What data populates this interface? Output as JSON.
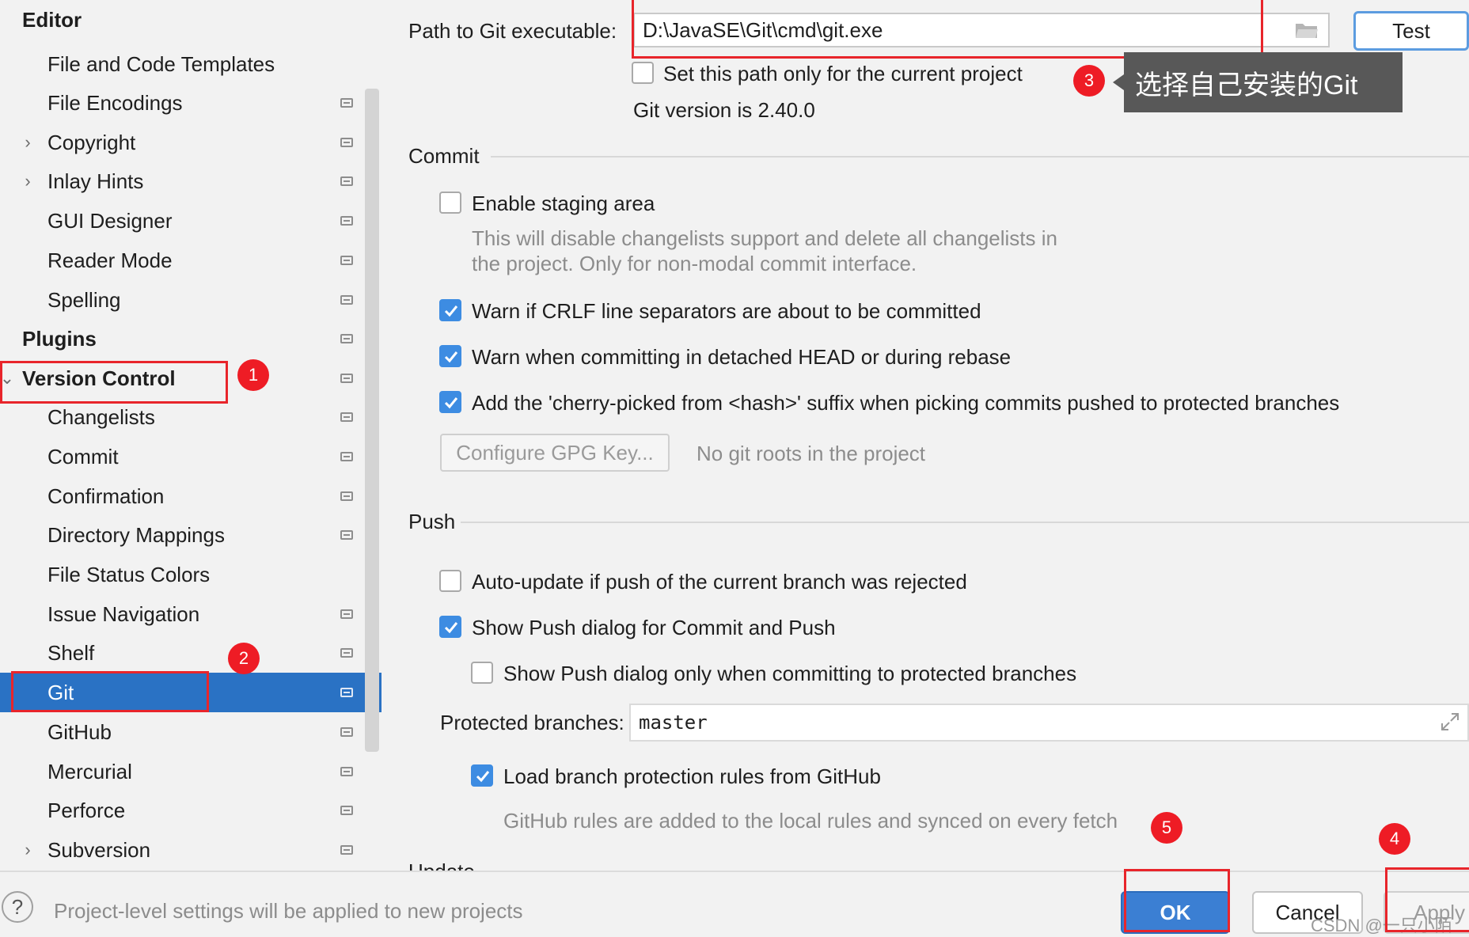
{
  "sidebar": {
    "items": [
      {
        "label": "Editor",
        "header": true,
        "chevron": "none"
      },
      {
        "label": "File and Code Templates",
        "chevron": "none",
        "project_icon": false
      },
      {
        "label": "File Encodings",
        "chevron": "none",
        "project_icon": true
      },
      {
        "label": "Copyright",
        "chevron": "collapsed",
        "project_icon": true
      },
      {
        "label": "Inlay Hints",
        "chevron": "collapsed",
        "project_icon": true
      },
      {
        "label": "GUI Designer",
        "chevron": "none",
        "project_icon": true
      },
      {
        "label": "Reader Mode",
        "chevron": "none",
        "project_icon": true
      },
      {
        "label": "Spelling",
        "chevron": "none",
        "project_icon": true
      },
      {
        "label": "Plugins",
        "header": true,
        "chevron": "none",
        "project_icon": true
      },
      {
        "label": "Version Control",
        "header": true,
        "chevron": "expanded",
        "project_icon": true
      },
      {
        "label": "Changelists",
        "chevron": "none",
        "project_icon": true
      },
      {
        "label": "Commit",
        "chevron": "none",
        "project_icon": true
      },
      {
        "label": "Confirmation",
        "chevron": "none",
        "project_icon": true
      },
      {
        "label": "Directory Mappings",
        "chevron": "none",
        "project_icon": true
      },
      {
        "label": "File Status Colors",
        "chevron": "none",
        "project_icon": false
      },
      {
        "label": "Issue Navigation",
        "chevron": "none",
        "project_icon": true
      },
      {
        "label": "Shelf",
        "chevron": "none",
        "project_icon": true
      },
      {
        "label": "Git",
        "chevron": "none",
        "project_icon": true,
        "selected": true
      },
      {
        "label": "GitHub",
        "chevron": "none",
        "project_icon": true
      },
      {
        "label": "Mercurial",
        "chevron": "none",
        "project_icon": true
      },
      {
        "label": "Perforce",
        "chevron": "none",
        "project_icon": true
      },
      {
        "label": "Subversion",
        "chevron": "collapsed",
        "project_icon": true
      }
    ]
  },
  "git": {
    "path_label": "Path to Git executable:",
    "path_value": "D:\\JavaSE\\Git\\cmd\\git.exe",
    "test_label": "Test",
    "current_project_only_label": "Set this path only for the current project",
    "current_project_only_checked": false,
    "version_text": "Git version is 2.40.0"
  },
  "commit": {
    "section_title": "Commit",
    "staging_label": "Enable staging area",
    "staging_checked": false,
    "staging_hint_1": "This will disable changelists support and delete all changelists in",
    "staging_hint_2": "the project. Only for non-modal commit interface.",
    "crlf_label": "Warn if CRLF line separators are about to be committed",
    "crlf_checked": true,
    "detached_label": "Warn when committing in detached HEAD or during rebase",
    "detached_checked": true,
    "cherry_label": "Add the 'cherry-picked from <hash>' suffix when picking commits pushed to protected branches",
    "cherry_checked": true,
    "gpg_button": "Configure GPG Key...",
    "gpg_status": "No git roots in the project"
  },
  "push": {
    "section_title": "Push",
    "autoupdate_label": "Auto-update if push of the current branch was rejected",
    "autoupdate_checked": false,
    "show_push_label": "Show Push dialog for Commit and Push",
    "show_push_checked": true,
    "protected_only_label": "Show Push dialog only when committing to protected branches",
    "protected_only_checked": false,
    "protected_branches_label": "Protected branches:",
    "protected_branches_value": "master",
    "github_rules_label": "Load branch protection rules from GitHub",
    "github_rules_checked": true,
    "github_rules_hint": "GitHub rules are added to the local rules and synced on every fetch"
  },
  "update": {
    "section_title_partial": "Update"
  },
  "annotations": {
    "tooltip": "选择自己安装的Git",
    "badges": [
      "1",
      "2",
      "3",
      "4",
      "5"
    ]
  },
  "footer": {
    "help": "?",
    "note": "Project-level settings will be applied to new projects",
    "ok": "OK",
    "cancel": "Cancel",
    "apply": "Apply",
    "watermark": "CSDN @一只小陌"
  },
  "colors": {
    "selection": "#2a72c4",
    "checkbox_on": "#3d8ce2",
    "annotation_red": "#e8252b",
    "ok_button": "#3b7fd3"
  }
}
